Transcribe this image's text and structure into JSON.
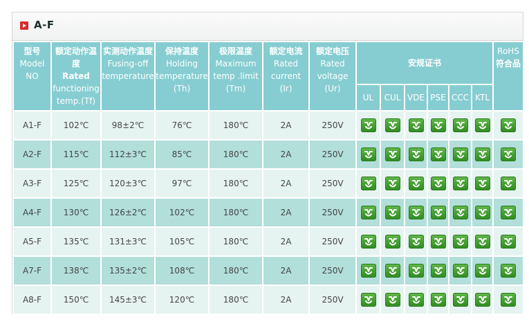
{
  "title": "A-F",
  "headers": {
    "model": {
      "cn": "型号",
      "en": [
        "Model",
        "NO"
      ]
    },
    "rated": {
      "cn": "额定动作温度",
      "en_bold": "Rated",
      "en": [
        "functioning",
        "temp.(Tf)"
      ]
    },
    "fusing": {
      "cn": "实测动作温度",
      "en": [
        "Fusing-off",
        "temperature"
      ]
    },
    "holding": {
      "cn": "保持温度",
      "en": [
        "Holding",
        "temperature",
        "(Th)"
      ]
    },
    "maximum": {
      "cn": "极限温度",
      "en": [
        "Maximum",
        "temp .limit",
        "(Tm)"
      ]
    },
    "current": {
      "cn": "额定电流",
      "en": [
        "Rated",
        "current",
        "(Ir)"
      ]
    },
    "voltage": {
      "cn": "额定电压",
      "en": [
        "Rated",
        "voltage",
        "(Ur)"
      ]
    },
    "certs_group": "安规证书",
    "certs": [
      "UL",
      "CUL",
      "VDE",
      "PSE",
      "CCC",
      "KTL"
    ],
    "rohs": {
      "en": "RoHS",
      "cn": "符合品"
    }
  },
  "rows": [
    {
      "model": "A1-F",
      "tf": "102℃",
      "fuse": "98±2℃",
      "th": "76℃",
      "tm": "180℃",
      "ir": "2A",
      "ur": "250V"
    },
    {
      "model": "A2-F",
      "tf": "115℃",
      "fuse": "112±3℃",
      "th": "85℃",
      "tm": "180℃",
      "ir": "2A",
      "ur": "250V"
    },
    {
      "model": "A3-F",
      "tf": "125℃",
      "fuse": "120±3℃",
      "th": "97℃",
      "tm": "180℃",
      "ir": "2A",
      "ur": "250V"
    },
    {
      "model": "A4-F",
      "tf": "130℃",
      "fuse": "126±2℃",
      "th": "102℃",
      "tm": "180℃",
      "ir": "2A",
      "ur": "250V"
    },
    {
      "model": "A5-F",
      "tf": "135℃",
      "fuse": "131±3℃",
      "th": "105℃",
      "tm": "180℃",
      "ir": "2A",
      "ur": "250V"
    },
    {
      "model": "A7-F",
      "tf": "138℃",
      "fuse": "135±2℃",
      "th": "108℃",
      "tm": "180℃",
      "ir": "2A",
      "ur": "250V"
    },
    {
      "model": "A8-F",
      "tf": "150℃",
      "fuse": "145±3℃",
      "th": "120℃",
      "tm": "180℃",
      "ir": "2A",
      "ur": "250V"
    }
  ],
  "cert_icon": "certification-check-icon",
  "colors": {
    "header_bg": "#86cdd1",
    "row_light": "#e6f4f1",
    "row_dark": "#b2dfda",
    "cert_green": "#3f9a2c",
    "title_icon_red": "#d92c2c"
  }
}
